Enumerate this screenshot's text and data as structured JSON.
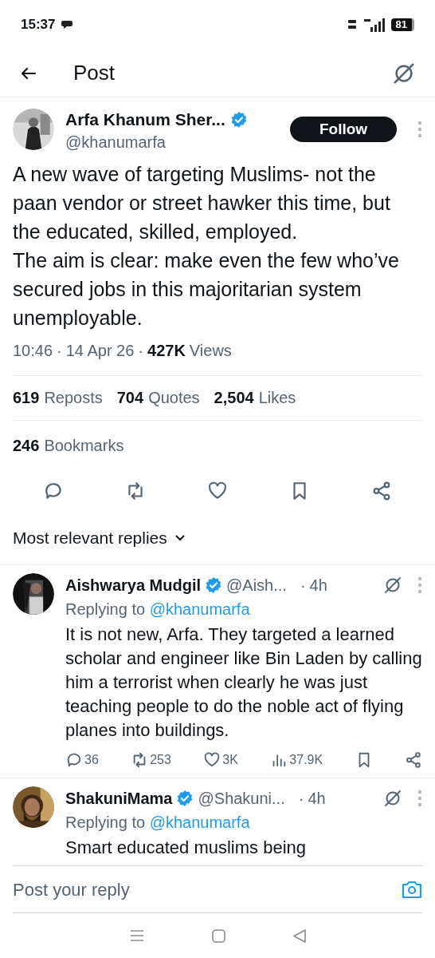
{
  "status_bar": {
    "time": "15:37",
    "battery": "81"
  },
  "header": {
    "title": "Post"
  },
  "post": {
    "author": {
      "name": "Arfa Khanum Sher...",
      "handle": "@khanumarfa",
      "verified": true
    },
    "follow_button": "Follow",
    "text": "A new wave of targeting Muslims- not the paan vendor or street hawker this time, but the educated, skilled, employed.\nThe aim is clear: make even the few who’ve secured jobs in this majoritarian system unemployable.",
    "time": "10:46",
    "separator": "·",
    "date": "14 Apr 26",
    "views_count": "427K",
    "views_label": "Views",
    "stats": [
      {
        "count": "619",
        "label": "Reposts"
      },
      {
        "count": "704",
        "label": "Quotes"
      },
      {
        "count": "2,504",
        "label": "Likes"
      }
    ],
    "bookmarks": {
      "count": "246",
      "label": "Bookmarks"
    }
  },
  "replies_header": "Most relevant replies",
  "replies": [
    {
      "name": "Aishwarya Mudgil",
      "verified": true,
      "handle": "@Aish...",
      "separator": "·",
      "time": "4h",
      "replying_prefix": "Replying to",
      "replying_to": "@khanumarfa",
      "text": "It is not new, Arfa. They targeted a learned scholar and engineer like Bin Laden by calling him a terrorist when clearly he was just teaching people to do the noble act of flying planes into buildings.",
      "actions": [
        {
          "kind": "reply",
          "count": "36"
        },
        {
          "kind": "repost",
          "count": "253"
        },
        {
          "kind": "like",
          "count": "3K"
        },
        {
          "kind": "views",
          "count": "37.9K"
        },
        {
          "kind": "bookmark"
        },
        {
          "kind": "share"
        }
      ]
    },
    {
      "name": "ShakuniMama",
      "verified": true,
      "handle": "@Shakuni...",
      "separator": "·",
      "time": "4h",
      "replying_prefix": "Replying to",
      "replying_to": "@khanumarfa",
      "text": "Smart educated muslims being"
    }
  ],
  "composer": {
    "placeholder": "Post your reply"
  }
}
